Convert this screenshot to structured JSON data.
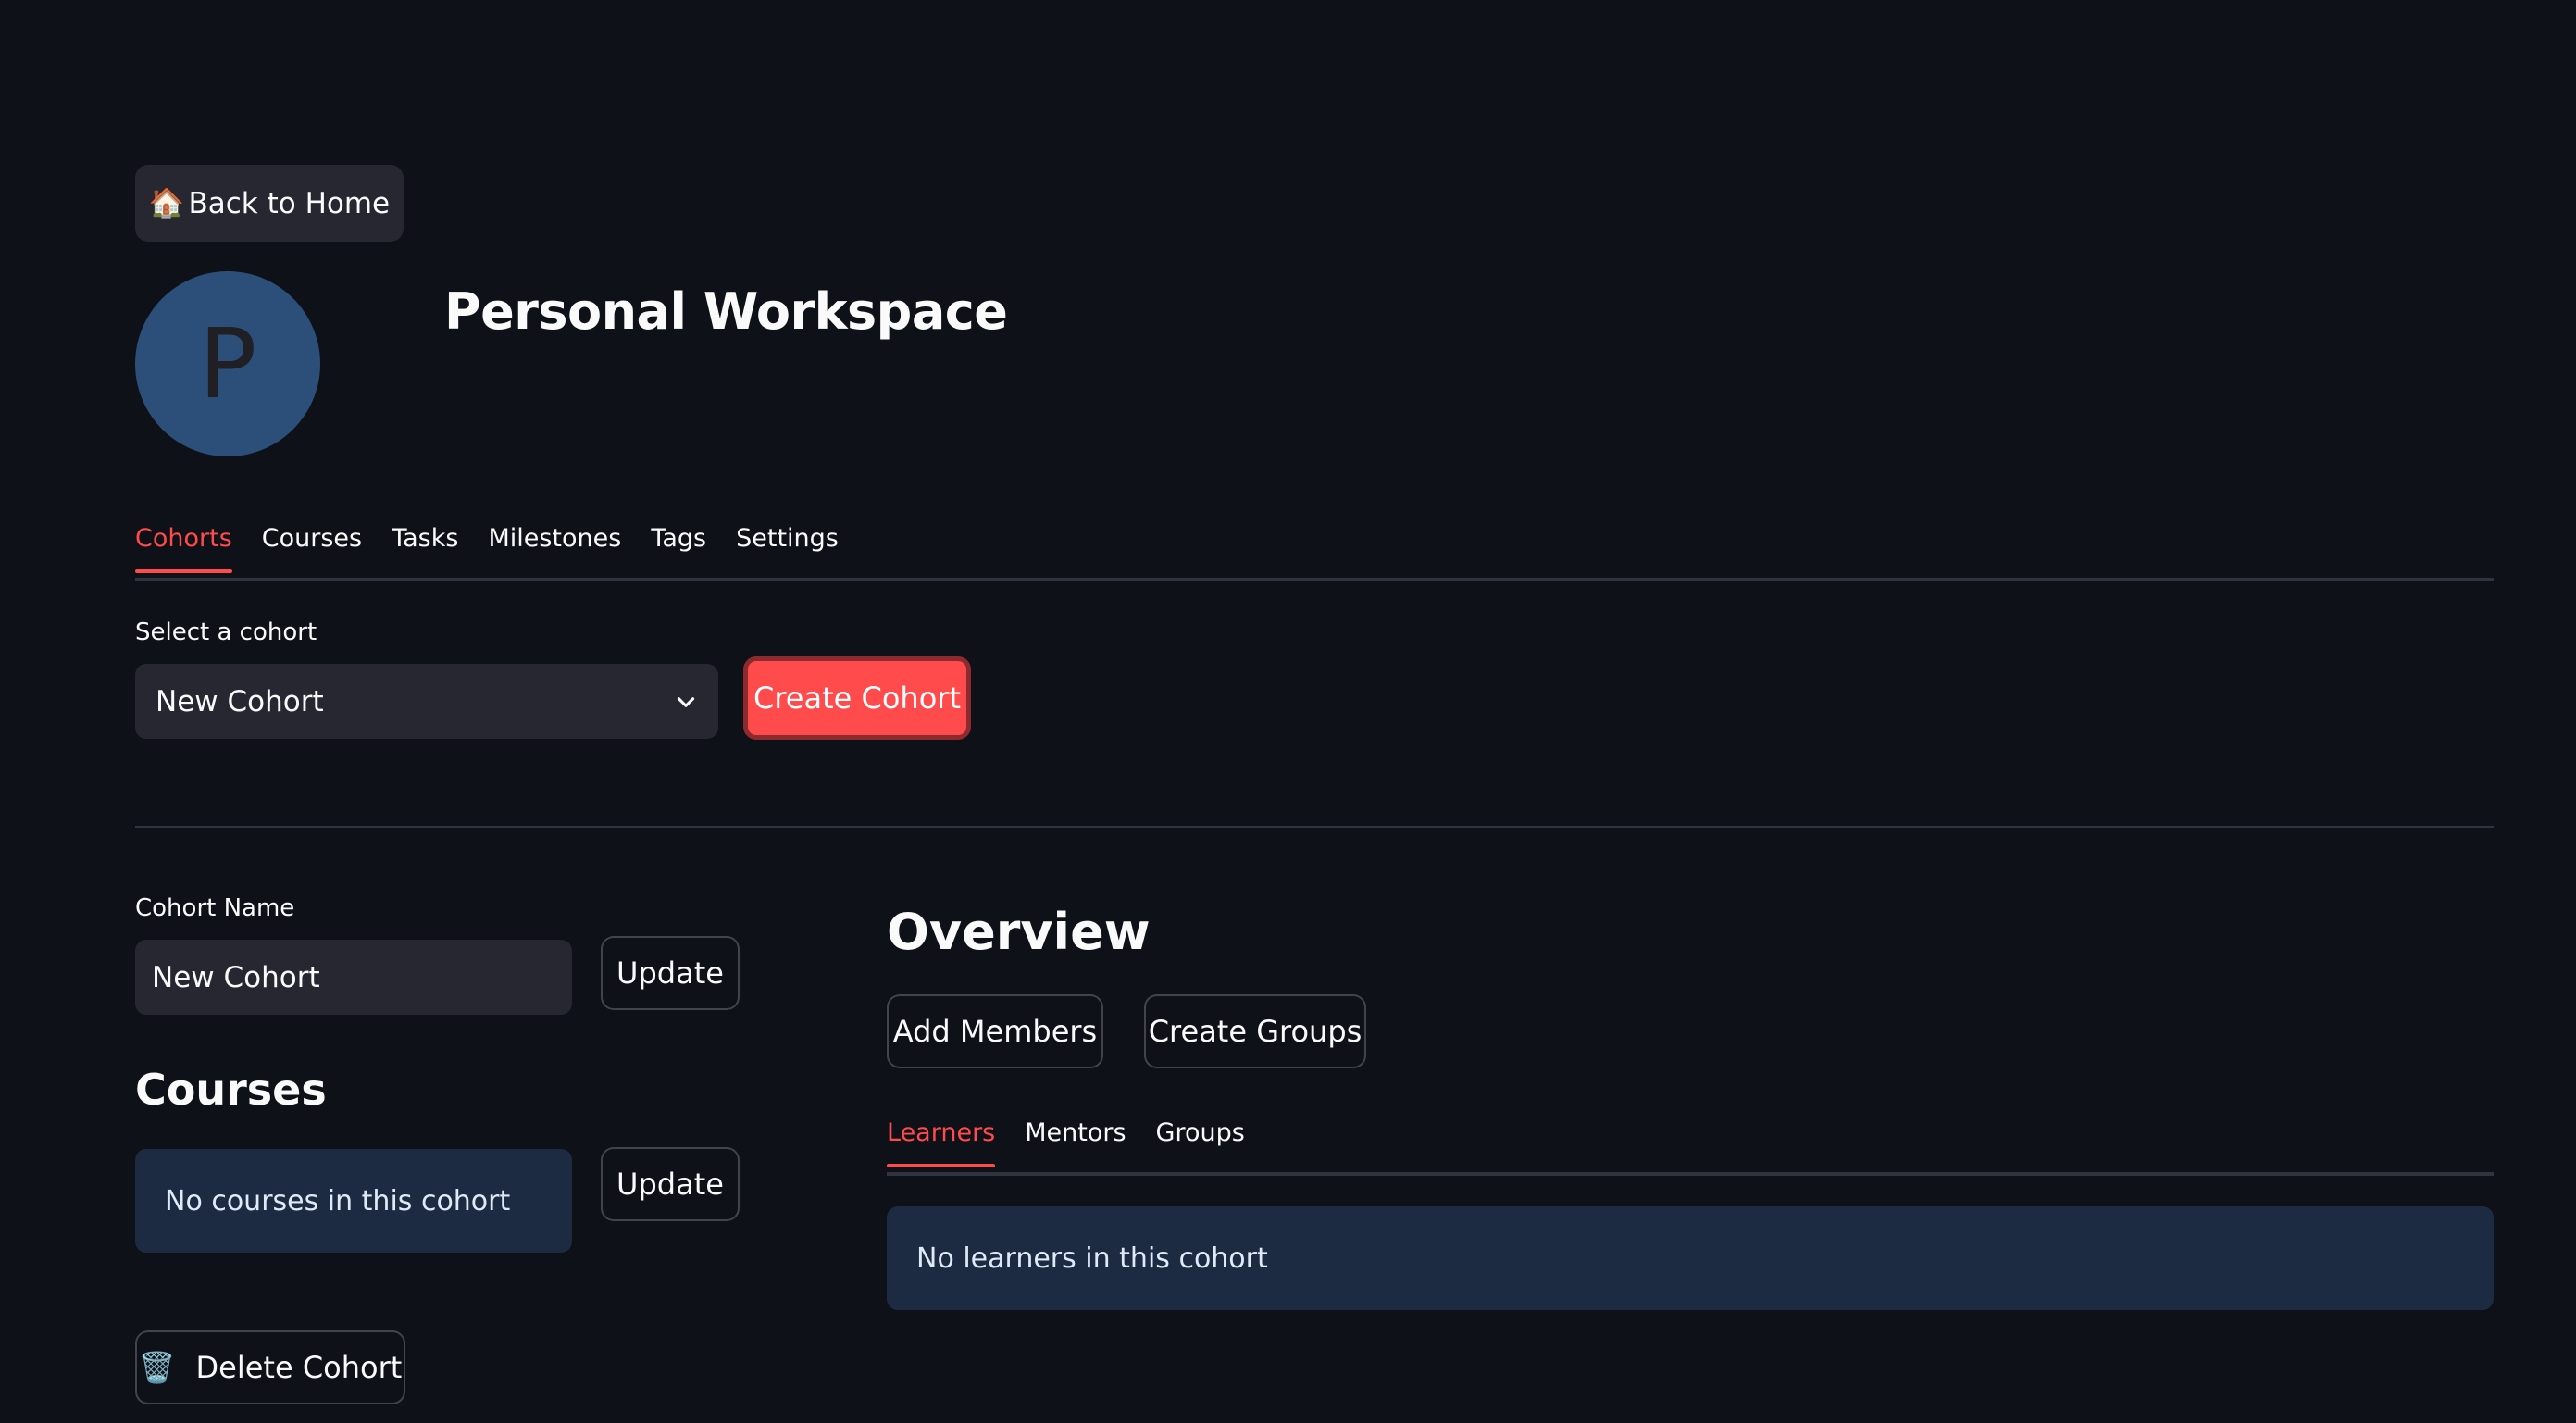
{
  "nav": {
    "back_icon": "🏠",
    "back_label": "Back to Home"
  },
  "workspace": {
    "avatar_letter": "P",
    "title": "Personal Workspace"
  },
  "main_tabs": [
    {
      "label": "Cohorts",
      "active": true
    },
    {
      "label": "Courses",
      "active": false
    },
    {
      "label": "Tasks",
      "active": false
    },
    {
      "label": "Milestones",
      "active": false
    },
    {
      "label": "Tags",
      "active": false
    },
    {
      "label": "Settings",
      "active": false
    }
  ],
  "cohort_select": {
    "label": "Select a cohort",
    "value": "New Cohort",
    "create_label": "Create Cohort"
  },
  "cohort_form": {
    "name_label": "Cohort Name",
    "name_value": "New Cohort",
    "update_label": "Update"
  },
  "courses": {
    "title": "Courses",
    "empty_message": "No courses in this cohort",
    "update_label": "Update"
  },
  "delete": {
    "icon": "🗑️",
    "label": "Delete Cohort"
  },
  "overview": {
    "title": "Overview",
    "add_members_label": "Add Members",
    "create_groups_label": "Create Groups",
    "tabs": [
      {
        "label": "Learners",
        "active": true
      },
      {
        "label": "Mentors",
        "active": false
      },
      {
        "label": "Groups",
        "active": false
      }
    ],
    "empty_message": "No learners in this cohort"
  },
  "colors": {
    "background": "#0e1117",
    "accent": "#ff4b4b",
    "info_bg": "#1c2a42",
    "avatar_bg": "#2c4f7a"
  }
}
